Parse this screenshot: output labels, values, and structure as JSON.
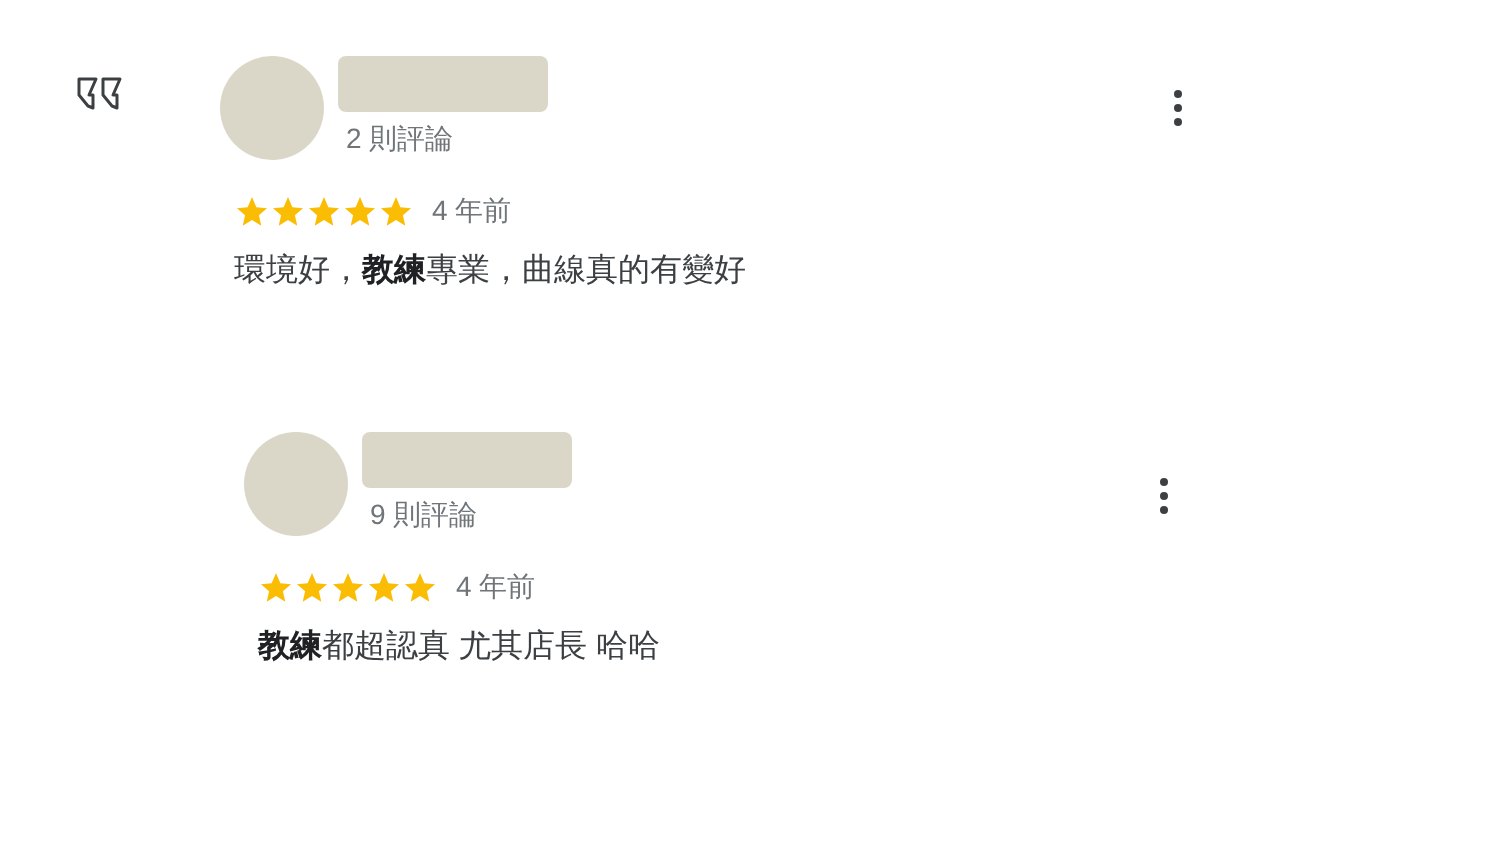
{
  "reviews": [
    {
      "review_count": "2 則評論",
      "stars": 5,
      "time": "4 年前",
      "text": "環境好，**教練**專業，曲線真的有變好"
    },
    {
      "review_count": "9 則評論",
      "stars": 5,
      "time": "4 年前",
      "text": "**教練**都超認真 尤其店長 哈哈"
    }
  ]
}
